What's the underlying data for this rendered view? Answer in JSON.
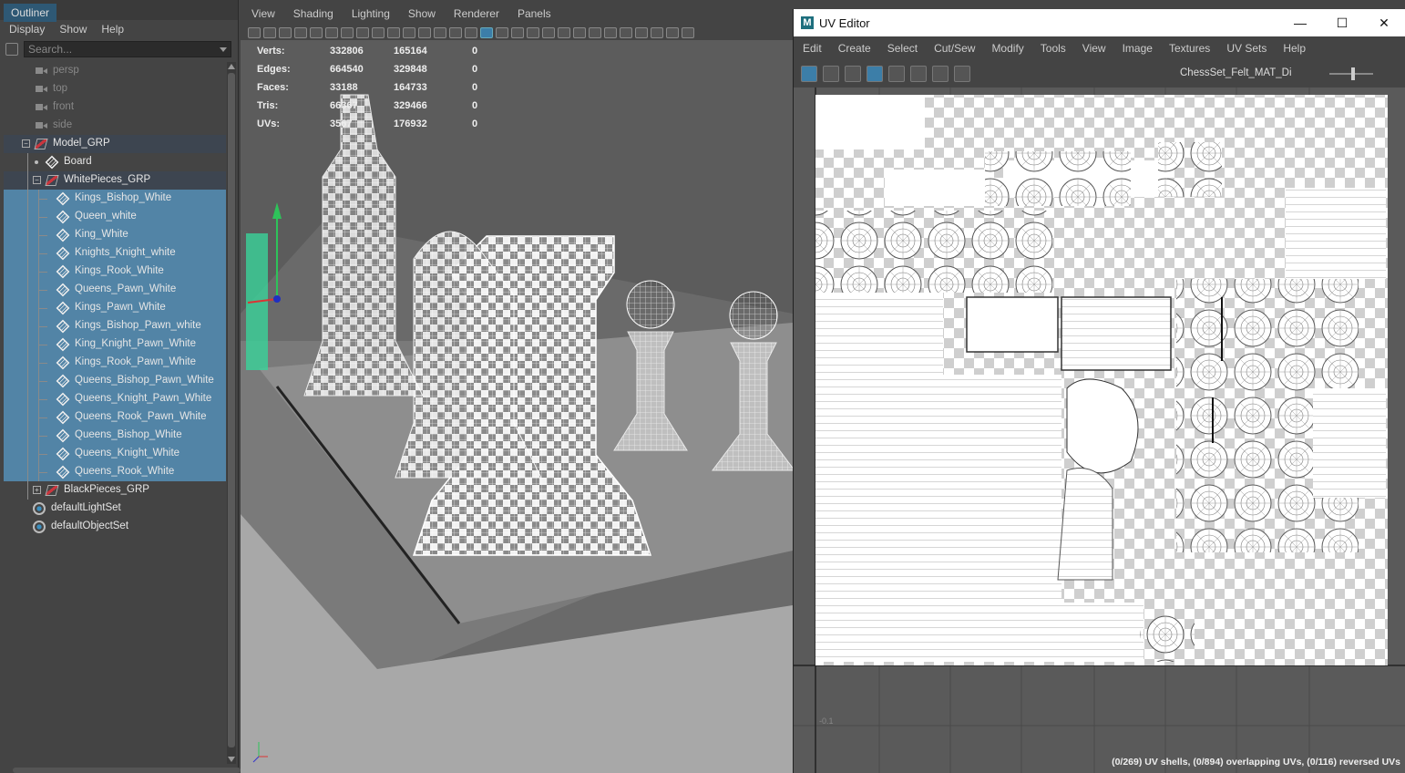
{
  "outliner": {
    "tab": "Outliner",
    "menu": [
      "Display",
      "Show",
      "Help"
    ],
    "search_placeholder": "Search...",
    "items": [
      {
        "label": "persp",
        "depth": 1,
        "icon": "camera-icon",
        "dim": true
      },
      {
        "label": "top",
        "depth": 1,
        "icon": "camera-icon",
        "dim": true
      },
      {
        "label": "front",
        "depth": 1,
        "icon": "camera-icon",
        "dim": true
      },
      {
        "label": "side",
        "depth": 1,
        "icon": "camera-icon",
        "dim": true
      },
      {
        "label": "Model_GRP",
        "depth": 1,
        "icon": "group-icon",
        "expander": "-",
        "grp": true
      },
      {
        "label": "Board",
        "depth": 2,
        "icon": "mesh-icon"
      },
      {
        "label": "WhitePieces_GRP",
        "depth": 2,
        "icon": "group-icon",
        "expander": "-",
        "grp": true
      },
      {
        "label": "Kings_Bishop_White",
        "depth": 3,
        "icon": "mesh-icon",
        "sel": true
      },
      {
        "label": "Queen_white",
        "depth": 3,
        "icon": "mesh-icon",
        "sel": true
      },
      {
        "label": "King_White",
        "depth": 3,
        "icon": "mesh-icon",
        "sel": true
      },
      {
        "label": "Knights_Knight_white",
        "depth": 3,
        "icon": "mesh-icon",
        "sel": true
      },
      {
        "label": "Kings_Rook_White",
        "depth": 3,
        "icon": "mesh-icon",
        "sel": true
      },
      {
        "label": "Queens_Pawn_White",
        "depth": 3,
        "icon": "mesh-icon",
        "sel": true
      },
      {
        "label": "Kings_Pawn_White",
        "depth": 3,
        "icon": "mesh-icon",
        "sel": true
      },
      {
        "label": "Kings_Bishop_Pawn_white",
        "depth": 3,
        "icon": "mesh-icon",
        "sel": true
      },
      {
        "label": "King_Knight_Pawn_White",
        "depth": 3,
        "icon": "mesh-icon",
        "sel": true
      },
      {
        "label": "Kings_Rook_Pawn_White",
        "depth": 3,
        "icon": "mesh-icon",
        "sel": true
      },
      {
        "label": "Queens_Bishop_Pawn_White",
        "depth": 3,
        "icon": "mesh-icon",
        "sel": true
      },
      {
        "label": "Queens_Knight_Pawn_White",
        "depth": 3,
        "icon": "mesh-icon",
        "sel": true
      },
      {
        "label": "Queens_Rook_Pawn_White",
        "depth": 3,
        "icon": "mesh-icon",
        "sel": true
      },
      {
        "label": "Queens_Bishop_White",
        "depth": 3,
        "icon": "mesh-icon",
        "sel": true
      },
      {
        "label": "Queens_Knight_White",
        "depth": 3,
        "icon": "mesh-icon",
        "sel": true
      },
      {
        "label": "Queens_Rook_White",
        "depth": 3,
        "icon": "mesh-icon",
        "sel": true
      },
      {
        "label": "BlackPieces_GRP",
        "depth": 2,
        "icon": "group-icon",
        "expander": "+"
      },
      {
        "label": "defaultLightSet",
        "depth": 0,
        "icon": "set-icon"
      },
      {
        "label": "defaultObjectSet",
        "depth": 0,
        "icon": "set-icon"
      }
    ]
  },
  "viewport": {
    "menu": [
      "View",
      "Shading",
      "Lighting",
      "Show",
      "Renderer",
      "Panels"
    ],
    "hud": [
      {
        "label": "Verts:",
        "a": "332806",
        "b": "165164",
        "c": "0"
      },
      {
        "label": "Edges:",
        "a": "664540",
        "b": "329848",
        "c": "0"
      },
      {
        "label": "Faces:",
        "a": "33188",
        "b": "164733",
        "c": "0"
      },
      {
        "label": "Tris:",
        "a": "66367",
        "b": "329466",
        "c": "0"
      },
      {
        "label": "UVs:",
        "a": "3567",
        "b": "176932",
        "c": "0"
      }
    ]
  },
  "uv_editor": {
    "title": "UV Editor",
    "menu": [
      "Edit",
      "Create",
      "Select",
      "Cut/Sew",
      "Modify",
      "Tools",
      "View",
      "Image",
      "Textures",
      "UV Sets",
      "Help"
    ],
    "texture": "ChessSet_Felt_MAT_Di",
    "tick_label": "-0.1",
    "status": "(0/269) UV shells, (0/894) overlapping UVs, (0/116) reversed UVs"
  },
  "colors": {
    "selection": "#5284a6",
    "panel": "#444444",
    "uv_accent": "#3c7ea8"
  }
}
